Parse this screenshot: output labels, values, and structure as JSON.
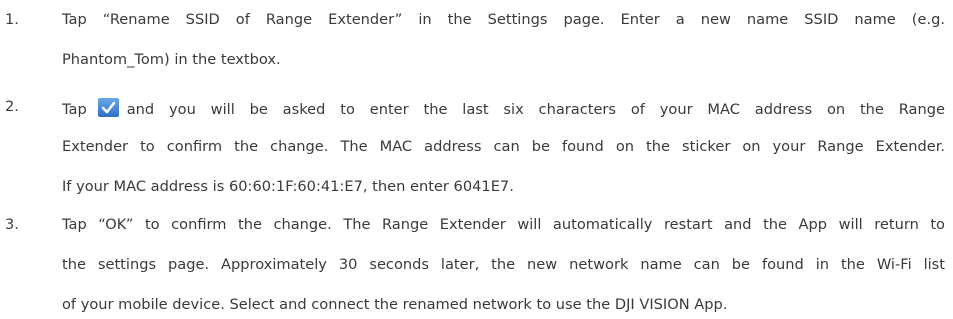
{
  "steps": [
    {
      "number": "1.",
      "lines": [
        "Tap “Rename SSID of Range Extender” in the Settings page. Enter a new name SSID name (e.g.",
        "Phantom_Tom) in the textbox."
      ]
    },
    {
      "number": "2.",
      "line1_before_icon": "Tap",
      "line1_after_icon": "and you will be asked to enter the last six characters of your MAC address on the Range",
      "icon": "checkmark-icon",
      "lines": [
        "Extender to confirm the change. The MAC address can be found on the sticker on your Range Extender.",
        "If your MAC address is 60:60:1F:60:41:E7, then enter 6041E7."
      ]
    },
    {
      "number": "3.",
      "lines": [
        "Tap “OK” to confirm the change. The Range Extender will automatically restart and the App will return to",
        "the settings page. Approximately 30 seconds later, the new network name can be found in the Wi-Fi list",
        "of your mobile device. Select and connect the renamed network to use the DJI VISION App."
      ]
    }
  ],
  "colors": {
    "text": "#3a3a3a",
    "icon_bg": "#3b7fd6",
    "icon_check": "#ffffff"
  }
}
